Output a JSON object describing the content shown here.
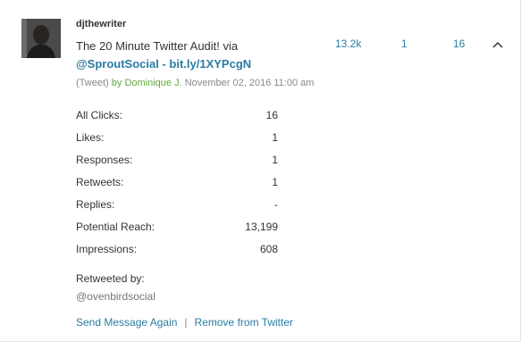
{
  "post": {
    "username": "djthewriter",
    "message_text": "The 20 Minute Twitter Audit! via",
    "message_link": "@SproutSocial - bit.ly/1XYPcgN",
    "stats": {
      "reach": "13.2k",
      "likes": "1",
      "clicks": "16"
    },
    "meta": {
      "type": "(Tweet)",
      "by_prefix": "by",
      "author": "Dominique J.",
      "timestamp": "November 02, 2016 11:00 am"
    }
  },
  "metrics": [
    {
      "label": "All Clicks:",
      "value": "16"
    },
    {
      "label": "Likes:",
      "value": "1"
    },
    {
      "label": "Responses:",
      "value": "1"
    },
    {
      "label": "Retweets:",
      "value": "1"
    },
    {
      "label": "Replies:",
      "value": "-"
    },
    {
      "label": "Potential Reach:",
      "value": "13,199"
    },
    {
      "label": "Impressions:",
      "value": "608"
    }
  ],
  "retweeted": {
    "label": "Retweeted by:",
    "user": "@ovenbirdsocial"
  },
  "actions": {
    "send_again": "Send Message Again",
    "separator": "|",
    "remove": "Remove from Twitter"
  },
  "icons": {
    "collapse": "chevron-up-icon"
  },
  "colors": {
    "link": "#2a7ca3",
    "author": "#64a83e"
  }
}
